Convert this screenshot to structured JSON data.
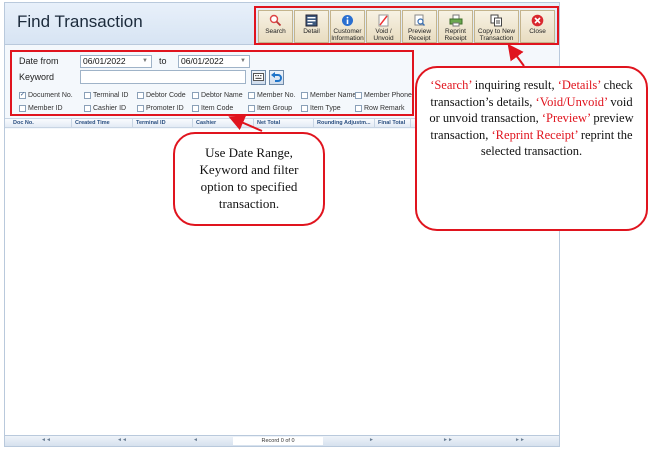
{
  "header": {
    "title": "Find Transaction"
  },
  "toolbar": {
    "buttons": [
      {
        "label": "Search",
        "icon": "search-icon"
      },
      {
        "label": "Detail",
        "icon": "detail-icon"
      },
      {
        "label": "Customer\nInformation",
        "icon": "info-icon"
      },
      {
        "label": "Void /\nUnvoid",
        "icon": "void-icon"
      },
      {
        "label": "Preview\nReceipt",
        "icon": "preview-icon"
      },
      {
        "label": "Reprint\nReceipt",
        "icon": "printer-icon"
      },
      {
        "label": "Copy to New\nTransaction",
        "icon": "copy-icon"
      },
      {
        "label": "Close",
        "icon": "close-icon"
      }
    ]
  },
  "filter": {
    "date_from_label": "Date from",
    "date_from_value": "06/01/2022",
    "to_label": "to",
    "date_to_value": "06/01/2022",
    "keyword_label": "Keyword",
    "keyword_value": "",
    "checkboxes": [
      {
        "label": "Document No.",
        "checked": true
      },
      {
        "label": "Terminal ID",
        "checked": false
      },
      {
        "label": "Debtor Code",
        "checked": false
      },
      {
        "label": "Debtor Name",
        "checked": false
      },
      {
        "label": "Member No.",
        "checked": false
      },
      {
        "label": "Member Name",
        "checked": false
      },
      {
        "label": "Member Phone",
        "checked": false
      },
      {
        "label": "Member ID",
        "checked": false
      },
      {
        "label": "Cashier ID",
        "checked": false
      },
      {
        "label": "Promoter ID",
        "checked": false
      },
      {
        "label": "Item Code",
        "checked": false
      },
      {
        "label": "Item Group",
        "checked": false
      },
      {
        "label": "Item Type",
        "checked": false
      },
      {
        "label": "Row Remark",
        "checked": false
      }
    ]
  },
  "grid": {
    "columns": [
      "Doc No.",
      "Created Time",
      "Terminal ID",
      "Cashier",
      "Net Total",
      "Rounding Adjustm...",
      "Final Total"
    ]
  },
  "footer": {
    "record_text": "Record 0 of 0"
  },
  "callouts": {
    "filter_note": "Use Date Range, Keyword and filter option to specified transaction.",
    "toolbar_note": [
      {
        "text": "‘Search’",
        "red": true
      },
      {
        "text": " inquiring result, ",
        "red": false
      },
      {
        "text": "‘Details’",
        "red": true
      },
      {
        "text": " check transaction’s details, ",
        "red": false
      },
      {
        "text": "‘Void/Unvoid’",
        "red": true
      },
      {
        "text": " void or unvoid transaction, ",
        "red": false
      },
      {
        "text": "‘Preview’",
        "red": true
      },
      {
        "text": " preview transaction, ",
        "red": false
      },
      {
        "text": "‘Reprint Receipt’",
        "red": true
      },
      {
        "text": " reprint the selected transaction.",
        "red": false
      }
    ]
  },
  "colors": {
    "accent": "#e0141e",
    "header_text": "#2a4f80"
  }
}
